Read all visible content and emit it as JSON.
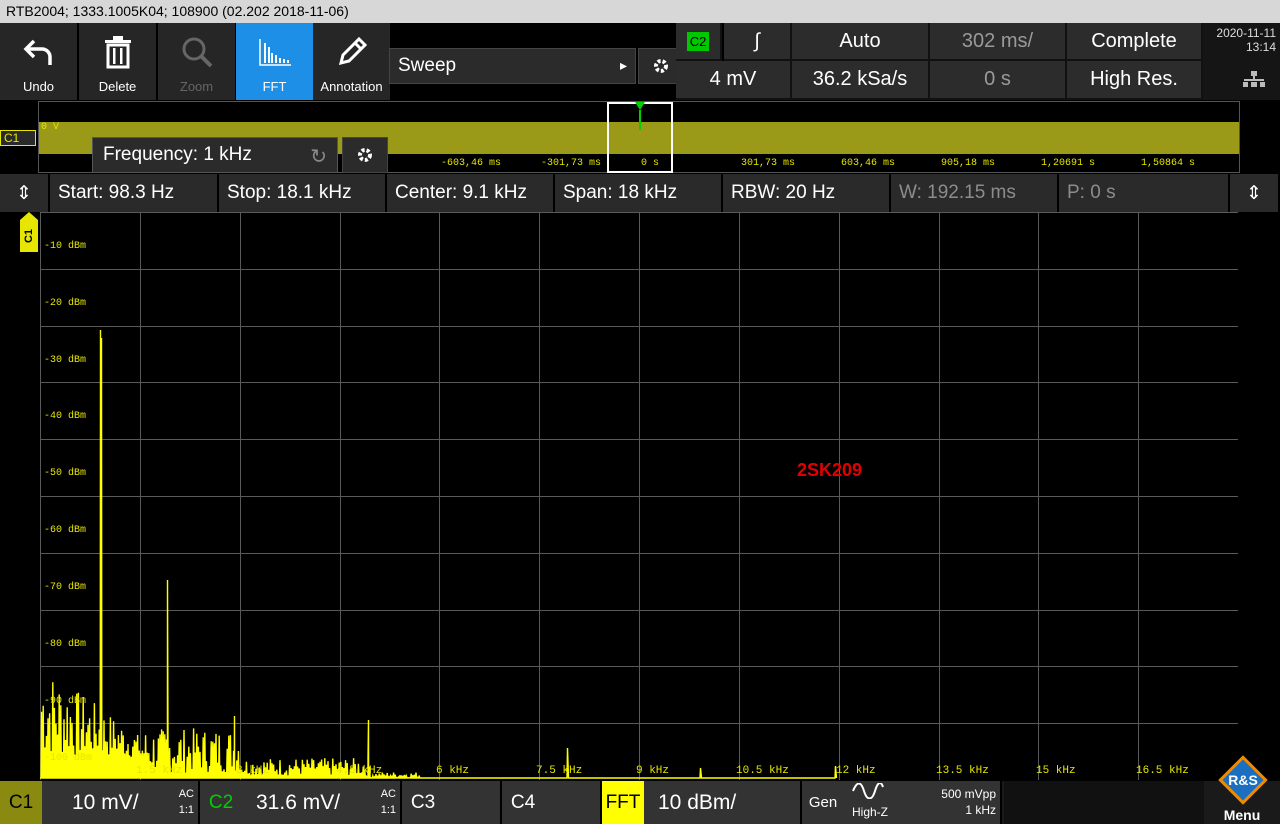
{
  "title": "RTB2004; 1333.1005K04; 108900 (02.202 2018-11-06)",
  "toolbar": [
    {
      "label": "Undo",
      "icon": "undo-icon"
    },
    {
      "label": "Delete",
      "icon": "trash-icon"
    },
    {
      "label": "Zoom",
      "icon": "zoom-icon",
      "disabled": true
    },
    {
      "label": "FFT",
      "icon": "fft-icon",
      "active": true
    },
    {
      "label": "Annotation",
      "icon": "pencil-icon"
    }
  ],
  "sweep": {
    "label": "Sweep"
  },
  "trigger": {
    "source": "C2",
    "level": "4 mV",
    "mode": "Auto",
    "sample_rate": "36.2 kSa/s",
    "timebase": "302 ms/",
    "position": "0 s",
    "acq_state": "Complete",
    "acq_mode": "High Res."
  },
  "clock": {
    "date": "2020-11-11",
    "time": "13:14"
  },
  "overview": {
    "channel": "C1",
    "zero_label": "0 V",
    "ticks": [
      "-603,46 ms",
      "-301,73 ms",
      "0 s",
      "301,73 ms",
      "603,46 ms",
      "905,18 ms",
      "1,20691 s",
      "1,50864 s"
    ],
    "popup_label": "Frequency: 1 kHz"
  },
  "fft_params": {
    "start": "Start: 98.3 Hz",
    "stop": "Stop: 18.1 kHz",
    "center": "Center: 9.1 kHz",
    "span": "Span: 18 kHz",
    "rbw": "RBW: 20 Hz",
    "window": "W: 192.15 ms",
    "position": "P: 0 s"
  },
  "plot": {
    "channel_tag": "C1",
    "ylabels": [
      "-10 dBm",
      "-20 dBm",
      "-30 dBm",
      "-40 dBm",
      "-50 dBm",
      "-60 dBm",
      "-70 dBm",
      "-80 dBm",
      "-90 dBm",
      "-100 dBm"
    ],
    "xlabels": [
      "1.5 kHz",
      "3 kHz",
      "4.5 kHz",
      "6 kHz",
      "7.5 kHz",
      "9 kHz",
      "10.5 kHz",
      "12 kHz",
      "13.5 kHz",
      "15 kHz",
      "16.5 kHz"
    ],
    "annotation": "2SK209",
    "colors": {
      "trace": "#ffff00",
      "grid": "#5a5a5a",
      "annotation": "#e00000"
    }
  },
  "bottom": {
    "c1": {
      "tag": "C1",
      "scale": "10 mV/",
      "coupling": "AC",
      "ratio": "1:1"
    },
    "c2": {
      "tag": "C2",
      "scale": "31.6 mV/",
      "coupling": "AC",
      "ratio": "1:1"
    },
    "c3": {
      "tag": "C3"
    },
    "c4": {
      "tag": "C4"
    },
    "fft": {
      "tag": "FFT",
      "scale": "10 dBm/"
    },
    "gen": {
      "tag": "Gen",
      "load": "High-Z",
      "amplitude": "500 mVpp",
      "freq": "1 kHz"
    },
    "menu": "Menu"
  }
}
